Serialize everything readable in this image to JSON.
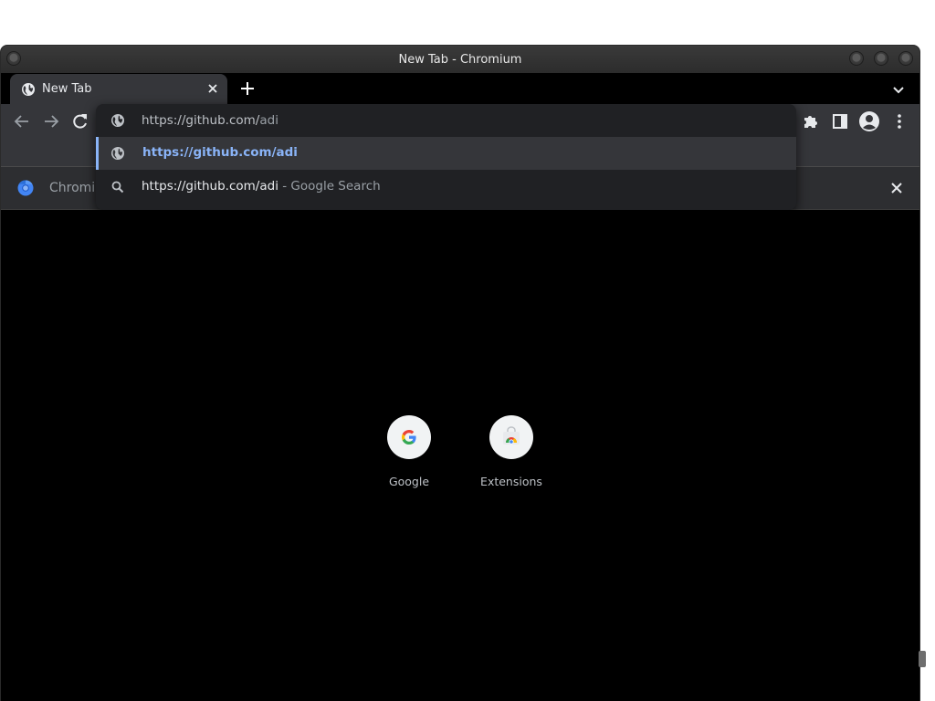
{
  "window": {
    "title": "New Tab - Chromium"
  },
  "tabs": [
    {
      "label": "New Tab",
      "icon": "globe-icon",
      "active": true
    }
  ],
  "toolbar": {
    "back_icon": "back-arrow-icon",
    "forward_icon": "forward-arrow-icon",
    "reload_icon": "reload-icon",
    "extensions_icon": "puzzle-icon",
    "side_panel_icon": "side-panel-icon",
    "profile_icon": "profile-avatar-icon",
    "menu_icon": "kebab-menu-icon"
  },
  "omnibox": {
    "input_prefix": "https://github.com/",
    "input_typed": "adi",
    "suggestions": [
      {
        "icon": "globe-icon",
        "text": "https://github.com/adi",
        "suffix": "",
        "selected": true
      },
      {
        "icon": "search-icon",
        "text": "https://github.com/adi",
        "suffix": " - Google Search",
        "selected": false
      }
    ]
  },
  "infobar": {
    "text": "Chromiu"
  },
  "shortcuts": [
    {
      "label": "Google",
      "icon": "google-g-icon"
    },
    {
      "label": "Extensions",
      "icon": "chrome-web-store-icon"
    }
  ],
  "colors": {
    "accent": "#8ab4f8",
    "toolbar": "#35363a",
    "background": "#000000",
    "popup": "#202124"
  }
}
